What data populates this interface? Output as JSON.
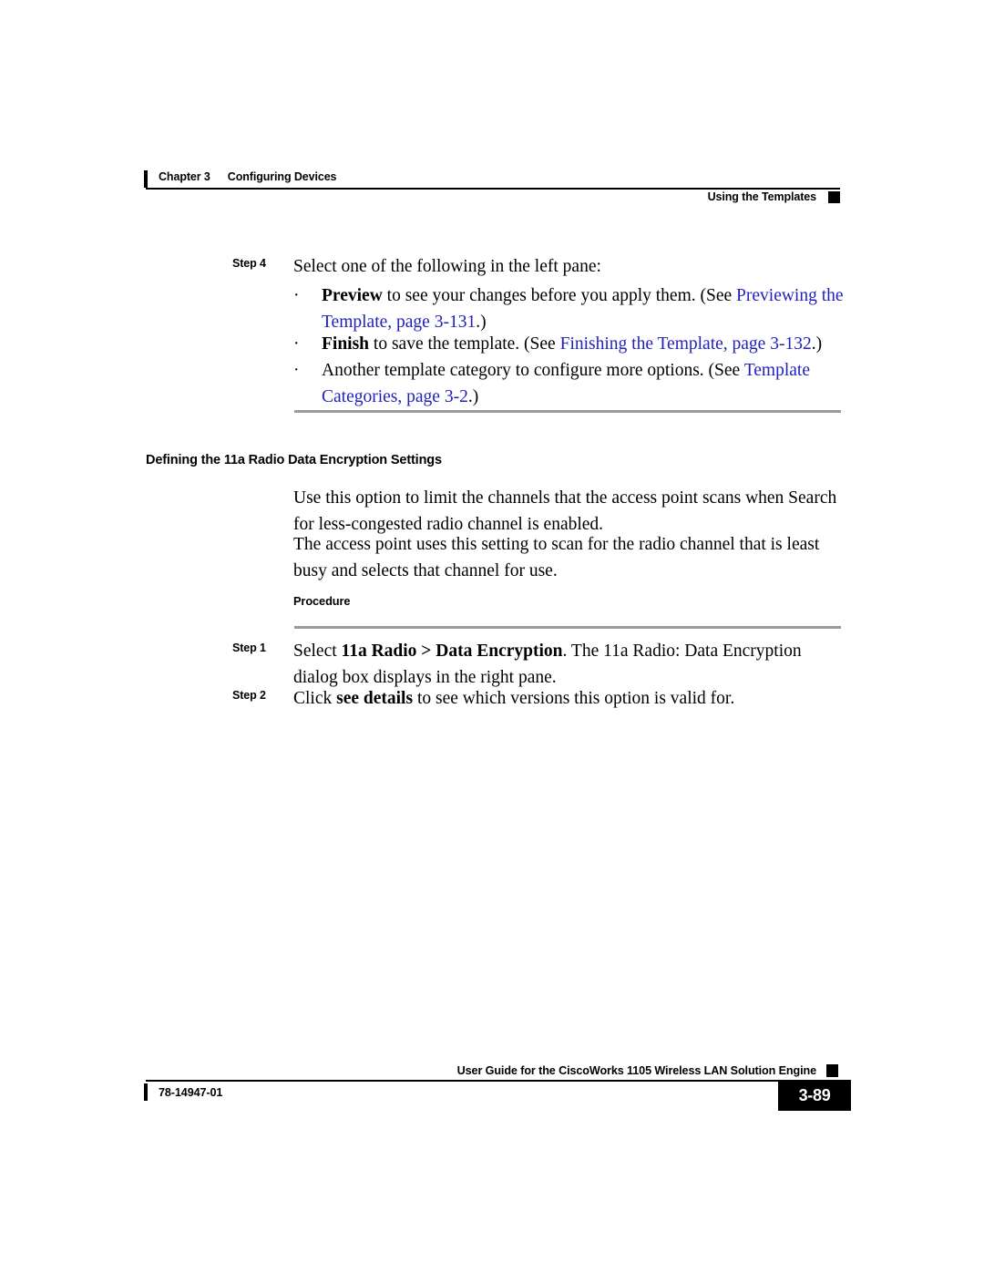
{
  "header": {
    "chapter_label": "Chapter 3",
    "chapter_title": "Configuring Devices",
    "section_running_head": "Using the Templates"
  },
  "colors": {
    "link": "#2222bb",
    "rule_gray": "#9a9a9a",
    "text": "#000000"
  },
  "body": {
    "step4": {
      "label": "Step 4",
      "text": "Select one of the following in the left pane:"
    },
    "bullets": [
      {
        "mark": "·",
        "bold_lead": "Preview",
        "text_before_link": " to see your changes before you apply them. (See ",
        "link_text": "Previewing the Template, page 3-131",
        "text_after_link": ".)"
      },
      {
        "mark": "·",
        "bold_lead": "Finish",
        "text_before_link": " to save the template. (See ",
        "link_text": "Finishing the Template, page 3-132",
        "text_after_link": ".)"
      },
      {
        "mark": "·",
        "bold_lead": "",
        "text_before_link": "Another template category to configure more options. (See ",
        "link_text": "Template Categories, page 3-2",
        "text_after_link": ".)"
      }
    ],
    "section_heading": "Defining the 11a Radio Data Encryption Settings",
    "paragraph_1": "Use this option to limit the channels that the access point scans when Search for less-congested radio channel is enabled.",
    "paragraph_2": "The access point uses this setting to scan for the radio channel that is least busy and selects that channel for use.",
    "procedure_heading": "Procedure",
    "step1": {
      "label": "Step 1",
      "text_before_bold": "Select ",
      "bold_text": "11a Radio > Data Encryption",
      "text_after_bold": ". The 11a Radio: Data Encryption dialog box displays in the right pane."
    },
    "step2": {
      "label": "Step 2",
      "text_before_bold": "Click ",
      "bold_text": "see details",
      "text_after_bold": " to see which versions this option is valid for."
    }
  },
  "footer": {
    "guide_title": "User Guide for the CiscoWorks 1105 Wireless LAN Solution Engine",
    "doc_number": "78-14947-01",
    "page_number": "3-89"
  }
}
